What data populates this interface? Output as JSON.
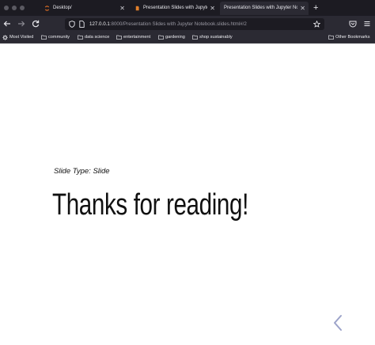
{
  "browser": {
    "tabs": [
      {
        "label": "Desktop/",
        "active": false
      },
      {
        "label": "Presentation Slides with Jupyter",
        "active": false
      },
      {
        "label": "Presentation Slides with Jupyter Notebook",
        "active": true
      }
    ],
    "url": {
      "host": "127.0.0.1",
      "path": ":8000/Presentation Slides with Jupyter Notebook.slides.html#/2"
    }
  },
  "bookmarks": {
    "items": [
      {
        "label": "Most Visited",
        "icon": "gear-icon"
      },
      {
        "label": "community",
        "icon": "folder-icon"
      },
      {
        "label": "data science",
        "icon": "folder-icon"
      },
      {
        "label": "entertainment",
        "icon": "folder-icon"
      },
      {
        "label": "gardening",
        "icon": "folder-icon"
      },
      {
        "label": "shop sustainably",
        "icon": "folder-icon"
      }
    ],
    "other": "Other Bookmarks"
  },
  "slide": {
    "type_label": "Slide Type: Slide",
    "title": "Thanks for reading!"
  },
  "colors": {
    "tabbar_bg": "#1c1b22",
    "toolbar_bg": "#2b2a33",
    "jupyter_orange": "#f37726",
    "nav_arrow": "#9ca3c9"
  }
}
